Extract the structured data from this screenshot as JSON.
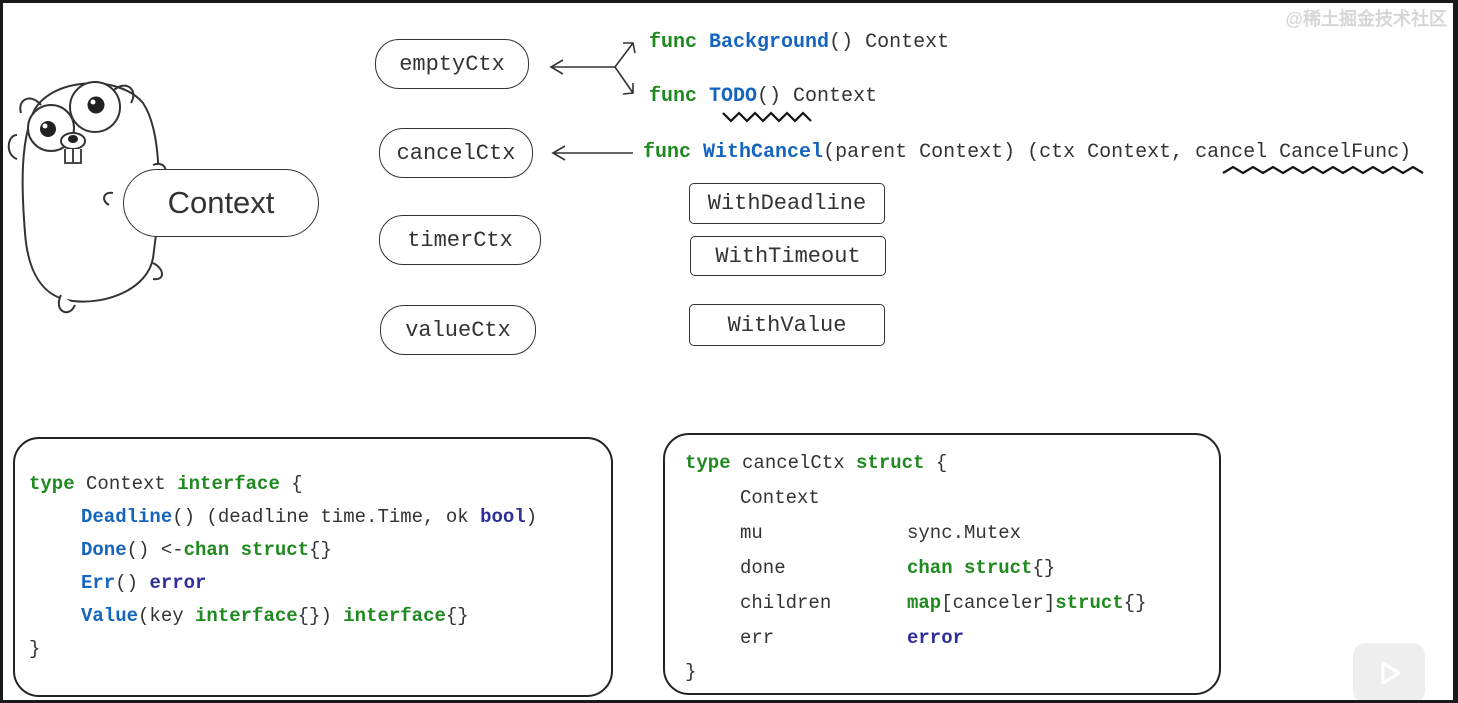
{
  "watermark": "@稀土掘金技术社区",
  "gopher_label": "Context",
  "ctx_types": [
    "emptyCtx",
    "cancelCtx",
    "timerCtx",
    "valueCtx"
  ],
  "funcs": {
    "background": {
      "kw": "func",
      "name": "Background",
      "rest": "() Context"
    },
    "todo": {
      "kw": "func",
      "name": "TODO",
      "rest": "() Context"
    },
    "withcancel": {
      "kw": "func",
      "name": "WithCancel",
      "params": "(parent Context) (ctx Context, ",
      "cancel": "cancel CancelFunc",
      "close": ")"
    }
  },
  "with_boxes": [
    "WithDeadline",
    "WithTimeout",
    "WithValue"
  ],
  "context_interface": {
    "l1_kw": "type",
    "l1_name": " Context ",
    "l1_kw2": "interface",
    "l1_brace": " {",
    "m1_name": "Deadline",
    "m1_rest": "() (deadline time.Time, ok ",
    "m1_type": "bool",
    "m1_close": ")",
    "m2_name": "Done",
    "m2_rest": "() <-",
    "m2_kw": "chan struct",
    "m2_close": "{}",
    "m3_name": "Err",
    "m3_rest": "() ",
    "m3_type": "error",
    "m4_name": "Value",
    "m4_rest": "(key ",
    "m4_kw": "interface",
    "m4_mid": "{}) ",
    "m4_kw2": "interface",
    "m4_close": "{}",
    "close": "}"
  },
  "cancelctx_struct": {
    "l1_kw": "type",
    "l1_name": " cancelCtx ",
    "l1_kw2": "struct",
    "l1_brace": " {",
    "f0": "Context",
    "f1_name": "mu",
    "f1_type": "sync.Mutex",
    "f2_name": "done",
    "f2_kw": "chan struct",
    "f2_close": "{}",
    "f3_name": "children",
    "f3_kw": "map",
    "f3_mid": "[canceler]",
    "f3_kw2": "struct",
    "f3_close": "{}",
    "f4_name": "err",
    "f4_type": "error",
    "close": "}"
  }
}
